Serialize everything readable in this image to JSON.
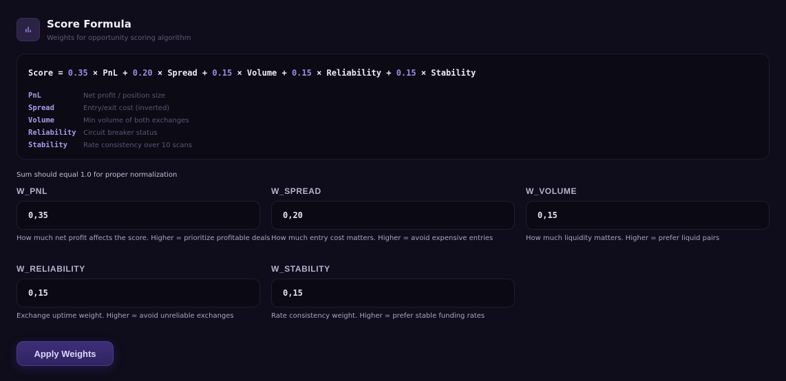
{
  "header": {
    "icon": "bar-chart-icon",
    "title": "Score Formula",
    "subtitle": "Weights for opportunity scoring algorithm"
  },
  "formula": {
    "parts": [
      {
        "text": "Score = ",
        "kind": "text"
      },
      {
        "text": "0.35",
        "kind": "num"
      },
      {
        "text": " × PnL + ",
        "kind": "text"
      },
      {
        "text": "0.20",
        "kind": "num"
      },
      {
        "text": " × Spread + ",
        "kind": "text"
      },
      {
        "text": "0.15",
        "kind": "num"
      },
      {
        "text": " × Volume + ",
        "kind": "text"
      },
      {
        "text": "0.15",
        "kind": "num"
      },
      {
        "text": " × Reliability + ",
        "kind": "text"
      },
      {
        "text": "0.15",
        "kind": "num"
      },
      {
        "text": " × Stability",
        "kind": "text"
      }
    ],
    "definitions": [
      {
        "term": "PnL",
        "desc": "Net profit / position size"
      },
      {
        "term": "Spread",
        "desc": "Entry/exit cost (inverted)"
      },
      {
        "term": "Volume",
        "desc": "Min volume of both exchanges"
      },
      {
        "term": "Reliability",
        "desc": "Circuit breaker status"
      },
      {
        "term": "Stability",
        "desc": "Rate consistency over 10 scans"
      }
    ]
  },
  "sum_note": "Sum should equal 1.0 for proper normalization",
  "fields": [
    {
      "label": "W_PNL",
      "value": "0,35",
      "help": "How much net profit affects the score. Higher = prioritize profitable deals"
    },
    {
      "label": "W_SPREAD",
      "value": "0,20",
      "help": "How much entry cost matters. Higher = avoid expensive entries"
    },
    {
      "label": "W_VOLUME",
      "value": "0,15",
      "help": "How much liquidity matters. Higher = prefer liquid pairs"
    },
    {
      "label": "W_RELIABILITY",
      "value": "0,15",
      "help": "Exchange uptime weight. Higher = avoid unreliable exchanges"
    },
    {
      "label": "W_STABILITY",
      "value": "0,15",
      "help": "Rate consistency weight. Higher = prefer stable funding rates"
    }
  ],
  "apply_label": "Apply Weights",
  "colors": {
    "accent": "#9b8ee0",
    "background": "#0f0d1b",
    "button": "#3d2f78"
  }
}
